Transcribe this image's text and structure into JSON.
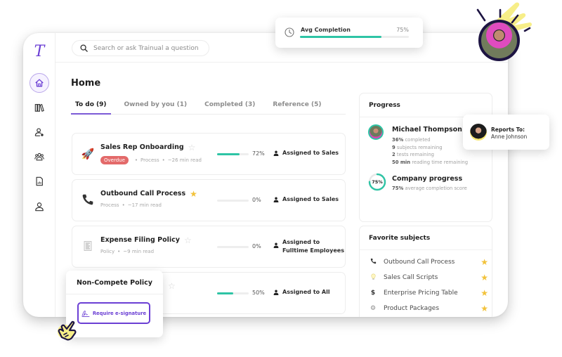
{
  "app": {
    "logo_glyph": "T"
  },
  "sidebar": {
    "items": [
      {
        "name": "home",
        "icon": "home-icon",
        "active": true
      },
      {
        "name": "library",
        "icon": "books-icon",
        "active": false
      },
      {
        "name": "users",
        "icon": "user-manage-icon",
        "active": false
      },
      {
        "name": "groups",
        "icon": "group-icon",
        "active": false
      },
      {
        "name": "reports",
        "icon": "document-chart-icon",
        "active": false
      },
      {
        "name": "profile",
        "icon": "person-icon",
        "active": false
      }
    ]
  },
  "search": {
    "placeholder": "Search or ask Trainual a question",
    "value": ""
  },
  "page": {
    "title": "Home"
  },
  "tabs": [
    {
      "label": "To do (9)",
      "active": true
    },
    {
      "label": "Owned by you (1)",
      "active": false
    },
    {
      "label": "Completed (3)",
      "active": false
    },
    {
      "label": "Reference (5)",
      "active": false
    }
  ],
  "tasks": [
    {
      "title": "Sales Rep Onboarding",
      "icon": "🚀",
      "icon_name": "rocket-icon",
      "starred": false,
      "badge": "Overdue",
      "type": "Process",
      "read_time": "~26 min read",
      "progress_pct": 72,
      "progress_label": "72%",
      "assigned": "Assigned to Sales"
    },
    {
      "title": "Outbound Call Process",
      "icon": "📞",
      "icon_name": "phone-icon",
      "starred": true,
      "badge": "",
      "type": "Process",
      "read_time": "~17 min read",
      "progress_pct": 0,
      "progress_label": "0%",
      "assigned": "Assigned to Sales"
    },
    {
      "title": "Expense Filing Policy",
      "icon": "🧾",
      "icon_name": "receipt-icon",
      "starred": false,
      "badge": "",
      "type": "Policy",
      "read_time": "~9 min read",
      "progress_pct": 0,
      "progress_label": "0%",
      "assigned_line1": "Assigned to",
      "assigned_line2": "Fulltime Employees"
    },
    {
      "title": "Non-Compete Policy",
      "icon": "",
      "icon_name": "document-icon",
      "starred": false,
      "badge": "",
      "type": "",
      "read_time": "",
      "progress_pct": 50,
      "progress_label": "50%",
      "assigned": "Assigned to All"
    }
  ],
  "progress_panel": {
    "header": "Progress",
    "person": {
      "name": "Michael Thompson",
      "completed_value": "36%",
      "completed_text": " completed",
      "subjects_value": "9",
      "subjects_text": " subjects remaining",
      "tests_value": "2",
      "tests_text": " tests remaining",
      "reading_value": "50 min",
      "reading_text": " reading time remaining"
    },
    "company": {
      "title": "Company progress",
      "ring_label": "75%",
      "ring_pct": 75,
      "score_value": "75%",
      "score_text": " average completion score"
    }
  },
  "favorites": {
    "header": "Favorite subjects",
    "items": [
      {
        "label": "Outbound Call Process",
        "icon": "📞",
        "icon_name": "phone-icon",
        "starred": true
      },
      {
        "label": "Sales Call Scripts",
        "icon": "💡",
        "icon_name": "lightbulb-icon",
        "starred": true
      },
      {
        "label": "Enterprise Pricing Table",
        "icon": "$",
        "icon_name": "dollar-icon",
        "starred": true
      },
      {
        "label": "Product Packages",
        "icon": "⚙",
        "icon_name": "gear-icon",
        "starred": true
      }
    ]
  },
  "avg_completion": {
    "label": "Avg Completion",
    "value_label": "75%",
    "value_pct": 75
  },
  "reports_to": {
    "label": "Reports To:",
    "name": "Anne Johnson"
  },
  "non_compete_popup": {
    "title": "Non-Compete Policy",
    "button_label": "Require e-signature"
  },
  "colors": {
    "accent": "#6b3fd4",
    "progress": "#2ec4a5",
    "overdue": "#e36a6a",
    "star": "#f2c23a"
  }
}
